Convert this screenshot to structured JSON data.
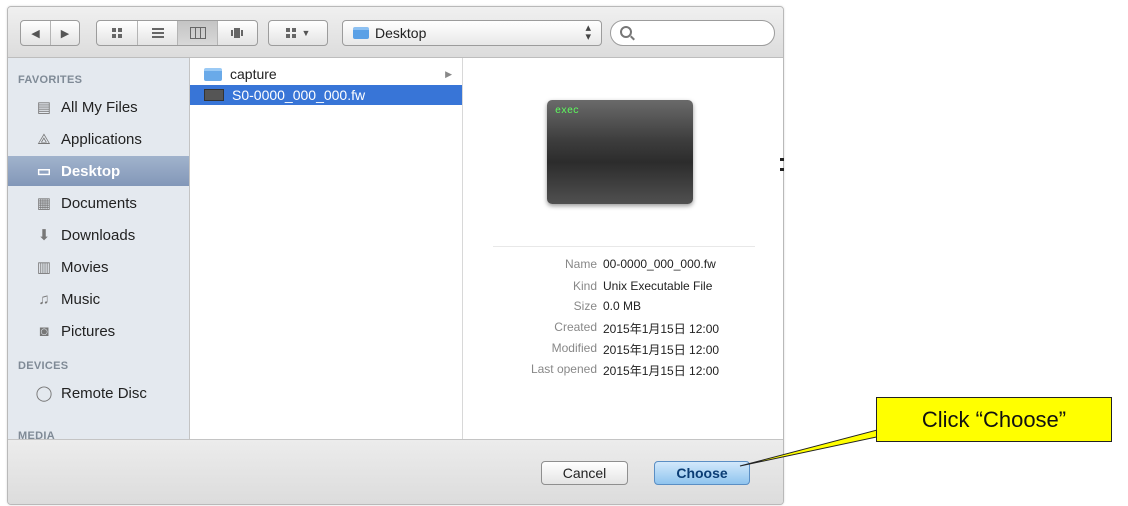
{
  "toolbar": {
    "path_label": "Desktop"
  },
  "sidebar": {
    "favorites_title": "FAVORITES",
    "favorites": [
      {
        "label": "All My Files",
        "icon": "all-files-icon"
      },
      {
        "label": "Applications",
        "icon": "applications-icon"
      },
      {
        "label": "Desktop",
        "icon": "desktop-icon",
        "selected": true
      },
      {
        "label": "Documents",
        "icon": "documents-icon"
      },
      {
        "label": "Downloads",
        "icon": "downloads-icon"
      },
      {
        "label": "Movies",
        "icon": "movies-icon"
      },
      {
        "label": "Music",
        "icon": "music-icon"
      },
      {
        "label": "Pictures",
        "icon": "pictures-icon"
      }
    ],
    "devices_title": "DEVICES",
    "devices": [
      {
        "label": "Remote Disc",
        "icon": "disc-icon"
      }
    ],
    "media_title": "MEDIA"
  },
  "files": [
    {
      "name": "capture",
      "type": "folder"
    },
    {
      "name": "S0-0000_000_000.fw",
      "type": "executable",
      "selected": true
    }
  ],
  "preview": {
    "icon_text": "exec",
    "info": [
      {
        "key": "Name",
        "value": "00-0000_000_000.fw"
      },
      {
        "key": "Kind",
        "value": "Unix Executable File"
      },
      {
        "key": "Size",
        "value": "0.0 MB"
      },
      {
        "key": "Created",
        "value": "2015年1月15日 12:00"
      },
      {
        "key": "Modified",
        "value": "2015年1月15日 12:00"
      },
      {
        "key": "Last opened",
        "value": "2015年1月15日 12:00"
      }
    ]
  },
  "buttons": {
    "cancel": "Cancel",
    "choose": "Choose"
  },
  "callout": {
    "text": "Click “Choose”",
    "color": "#ffff00"
  },
  "colors": {
    "selection": "#3875d7",
    "sidebar_selected": "#8a9ebe"
  }
}
